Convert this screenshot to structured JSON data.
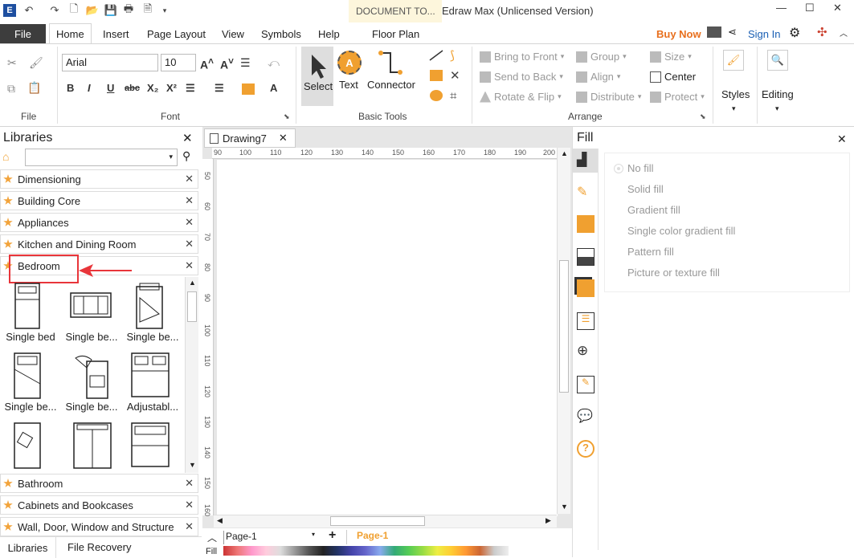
{
  "app": {
    "document_tab": "DOCUMENT TO...",
    "window_title": "Edraw Max (Unlicensed Version)"
  },
  "menu": {
    "file": "File",
    "tabs": [
      "Home",
      "Insert",
      "Page Layout",
      "View",
      "Symbols",
      "Help"
    ],
    "context_tab": "Floor Plan",
    "buy_now": "Buy Now",
    "sign_in": "Sign In"
  },
  "ribbon": {
    "groups": {
      "file": "File",
      "font": "Font",
      "basic_tools": "Basic Tools",
      "arrange": "Arrange"
    },
    "font_name": "Arial",
    "font_size": "10",
    "tools": {
      "select": "Select",
      "text": "Text",
      "connector": "Connector"
    },
    "arrange": {
      "bring_to_front": "Bring to Front",
      "send_to_back": "Send to Back",
      "rotate_flip": "Rotate & Flip",
      "group": "Group",
      "align": "Align",
      "distribute": "Distribute",
      "size": "Size",
      "center": "Center",
      "protect": "Protect"
    },
    "styles": "Styles",
    "editing": "Editing"
  },
  "libraries": {
    "title": "Libraries",
    "items_top": [
      "Dimensioning",
      "Building Core",
      "Appliances",
      "Kitchen and Dining Room"
    ],
    "active": "Bedroom",
    "shapes": [
      "Single bed",
      "Single be...",
      "Single be...",
      "Single be...",
      "Single be...",
      "Adjustabl..."
    ],
    "items_bottom": [
      "Bathroom",
      "Cabinets and Bookcases",
      "Wall, Door, Window and Structure"
    ],
    "bottom_tabs": [
      "Libraries",
      "File Recovery"
    ]
  },
  "canvas": {
    "tab": "Drawing7",
    "ruler_h": [
      "90",
      "100",
      "110",
      "120",
      "130",
      "140",
      "150",
      "160",
      "170",
      "180",
      "190",
      "200"
    ],
    "ruler_v": [
      "50",
      "60",
      "70",
      "80",
      "90",
      "100",
      "110",
      "120",
      "130",
      "140",
      "150",
      "160"
    ],
    "page_select": "Page-1",
    "page_tab": "Page-1",
    "fill_label": "Fill"
  },
  "fill_panel": {
    "title": "Fill",
    "options": [
      "No fill",
      "Solid fill",
      "Gradient fill",
      "Single color gradient fill",
      "Pattern fill",
      "Picture or texture fill"
    ],
    "selected": "No fill"
  },
  "colors": {
    "accent_orange": "#f0a030",
    "annotation_red": "#e8353a",
    "buy_now": "#e8701e",
    "sign_in": "#1a5fb4"
  }
}
